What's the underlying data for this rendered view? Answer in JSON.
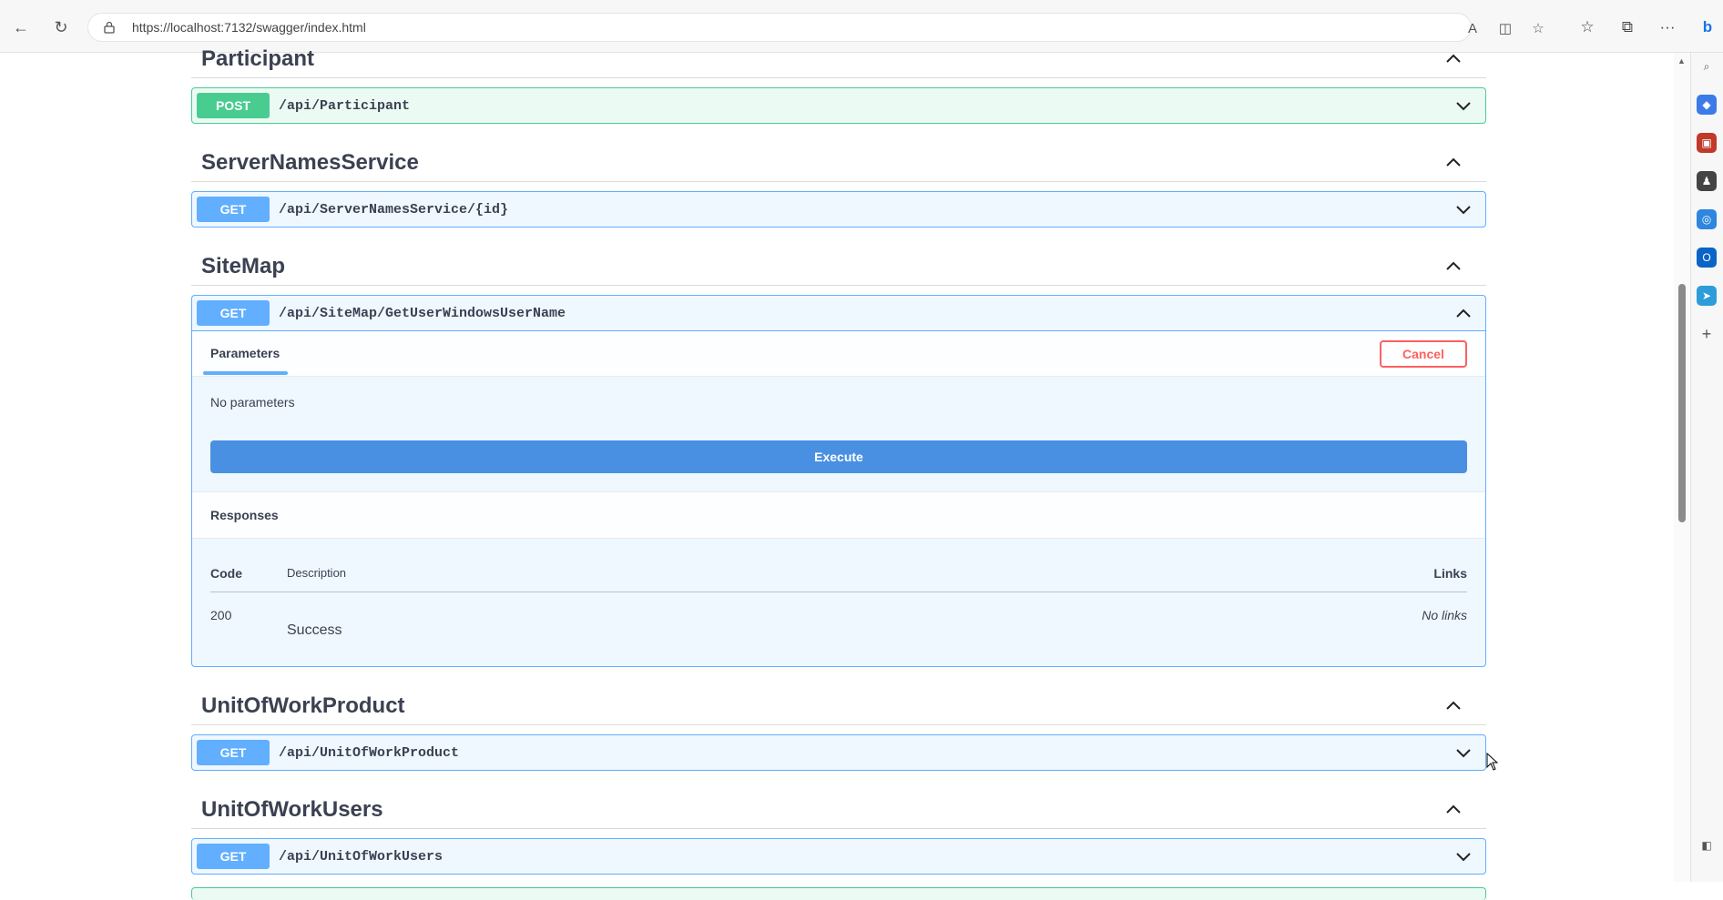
{
  "browser": {
    "url": "https://localhost:7132/swagger/index.html"
  },
  "sections": [
    {
      "title": "Participant",
      "ops": [
        {
          "method": "POST",
          "path": "/api/Participant"
        }
      ]
    },
    {
      "title": "ServerNamesService",
      "ops": [
        {
          "method": "GET",
          "path": "/api/ServerNamesService/{id}"
        }
      ]
    },
    {
      "title": "SiteMap",
      "ops": [
        {
          "method": "GET",
          "path": "/api/SiteMap/GetUserWindowsUserName"
        }
      ]
    },
    {
      "title": "UnitOfWorkProduct",
      "ops": [
        {
          "method": "GET",
          "path": "/api/UnitOfWorkProduct"
        }
      ]
    },
    {
      "title": "UnitOfWorkUsers",
      "ops": [
        {
          "method": "GET",
          "path": "/api/UnitOfWorkUsers"
        }
      ]
    }
  ],
  "expanded_op": {
    "params_tab": "Parameters",
    "cancel_label": "Cancel",
    "no_params": "No parameters",
    "execute_label": "Execute",
    "responses_label": "Responses",
    "col_code": "Code",
    "col_description": "Description",
    "col_links": "Links",
    "response": {
      "code": "200",
      "description": "Success",
      "links": "No links"
    }
  },
  "colors": {
    "post": "#49cc90",
    "get": "#61affe",
    "execute": "#4990e2",
    "cancel": "#ff6060"
  }
}
